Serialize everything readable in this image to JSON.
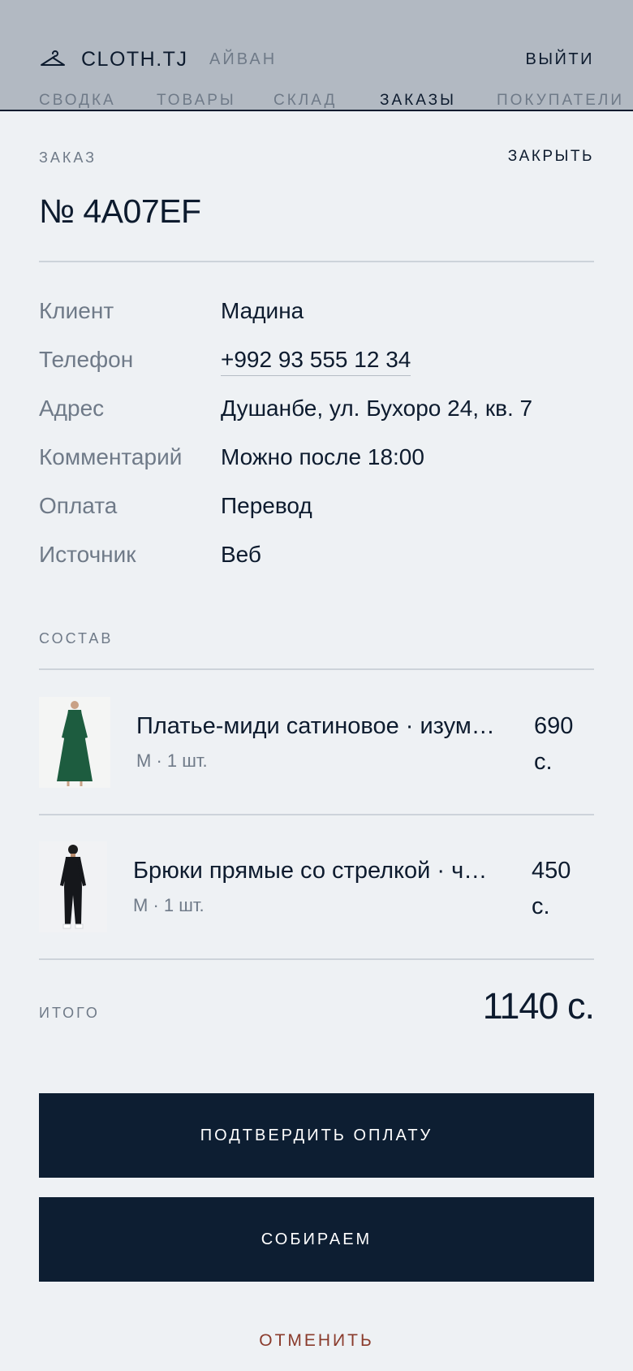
{
  "header": {
    "brand": "CLOTH.TJ",
    "brand_icon": "hanger-icon",
    "user": "АЙВАН",
    "logout_label": "ВЫЙТИ",
    "nav": [
      "СВОДКА",
      "ТОВАРЫ",
      "СКЛАД",
      "ЗАКАЗЫ",
      "ПОКУПАТЕЛИ"
    ],
    "nav_active": "ЗАКАЗЫ"
  },
  "order": {
    "label": "ЗАКАЗ",
    "close_label": "ЗАКРЫТЬ",
    "number": "№ 4A07EF",
    "details": [
      {
        "key": "Клиент",
        "value": "Мадина"
      },
      {
        "key": "Телефон",
        "value": "+992 93 555 12 34"
      },
      {
        "key": "Адрес",
        "value": "Душанбе, ул. Бухоро 24, кв. 7"
      },
      {
        "key": "Комментарий",
        "value": "Можно после 18:00"
      },
      {
        "key": "Оплата",
        "value": "Перевод"
      },
      {
        "key": "Источник",
        "value": "Веб"
      }
    ]
  },
  "composition": {
    "label": "СОСТАВ",
    "items": [
      {
        "name": "Платье-миди сатиновое · изумрудное",
        "meta": "M · 1 шт.",
        "price": "690 с.",
        "thumb_color": "#1d5c3f"
      },
      {
        "name": "Брюки прямые со стрелкой · чёрные",
        "meta": "M · 1 шт.",
        "price": "450 с.",
        "thumb_color": "#15171b"
      }
    ]
  },
  "total": {
    "label": "ИТОГО",
    "value": "1140 с."
  },
  "actions": {
    "confirm_payment": "ПОДТВЕРДИТЬ ОПЛАТУ",
    "collecting": "СОБИРАЕМ",
    "cancel": "ОТМЕНИТЬ"
  },
  "colors": {
    "primary": "#0d1e32",
    "muted": "#6f7a88",
    "danger": "#8a3b2c",
    "background": "#eef1f4"
  }
}
